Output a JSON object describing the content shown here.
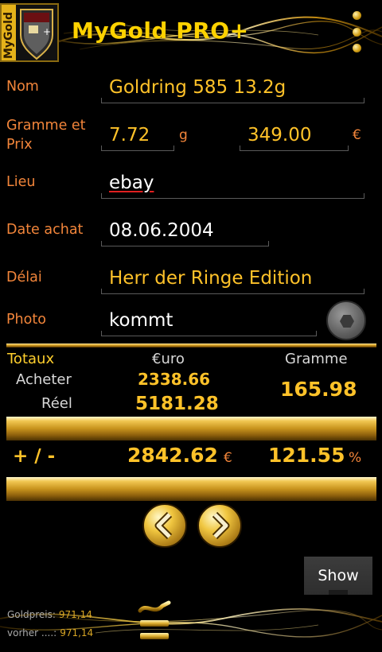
{
  "header": {
    "title": "MyGold PRO+",
    "logo_text": "MyGold",
    "menu_icon": "overflow-menu-icon"
  },
  "form": {
    "nom": {
      "label": "Nom",
      "value": "Goldring 585 13.2g"
    },
    "gramme_prix": {
      "label_line1": "Gramme et",
      "label_line2": "Prix",
      "grams": "7.72",
      "grams_unit": "g",
      "price": "349.00",
      "price_unit": "€"
    },
    "lieu": {
      "label": "Lieu",
      "value": "ebay"
    },
    "date": {
      "label": "Date achat",
      "value": "08.06.2004"
    },
    "delai": {
      "label": "Délai",
      "value": "Herr der Ringe Edition"
    },
    "photo": {
      "label": "Photo",
      "value": "kommt",
      "camera_icon": "camera-icon"
    }
  },
  "totals": {
    "title": "Totaux",
    "col_euro": "€uro",
    "col_gramme": "Gramme",
    "acheter_label": "Acheter",
    "acheter_value": "2338.66",
    "reel_label": "Réel",
    "reel_value": "5181.28",
    "gramme_value": "165.98",
    "diff_label": "+ / -",
    "diff_value": "2842.62",
    "diff_unit": "€",
    "diff_pct": "121.55",
    "diff_pct_unit": "%"
  },
  "nav": {
    "prev_icon": "chevron-left-icon",
    "next_icon": "chevron-right-icon"
  },
  "show_button": "Show",
  "footer": {
    "goldpreis_label": "Goldpreis:",
    "goldpreis_value": "971,14",
    "vorher_label": "vorher ....:",
    "vorher_value": "971,14",
    "equals_icon": "approx-equal-icon"
  },
  "colors": {
    "accent_gold": "#ffc229",
    "label_orange": "#f2853a",
    "background": "#000000"
  }
}
